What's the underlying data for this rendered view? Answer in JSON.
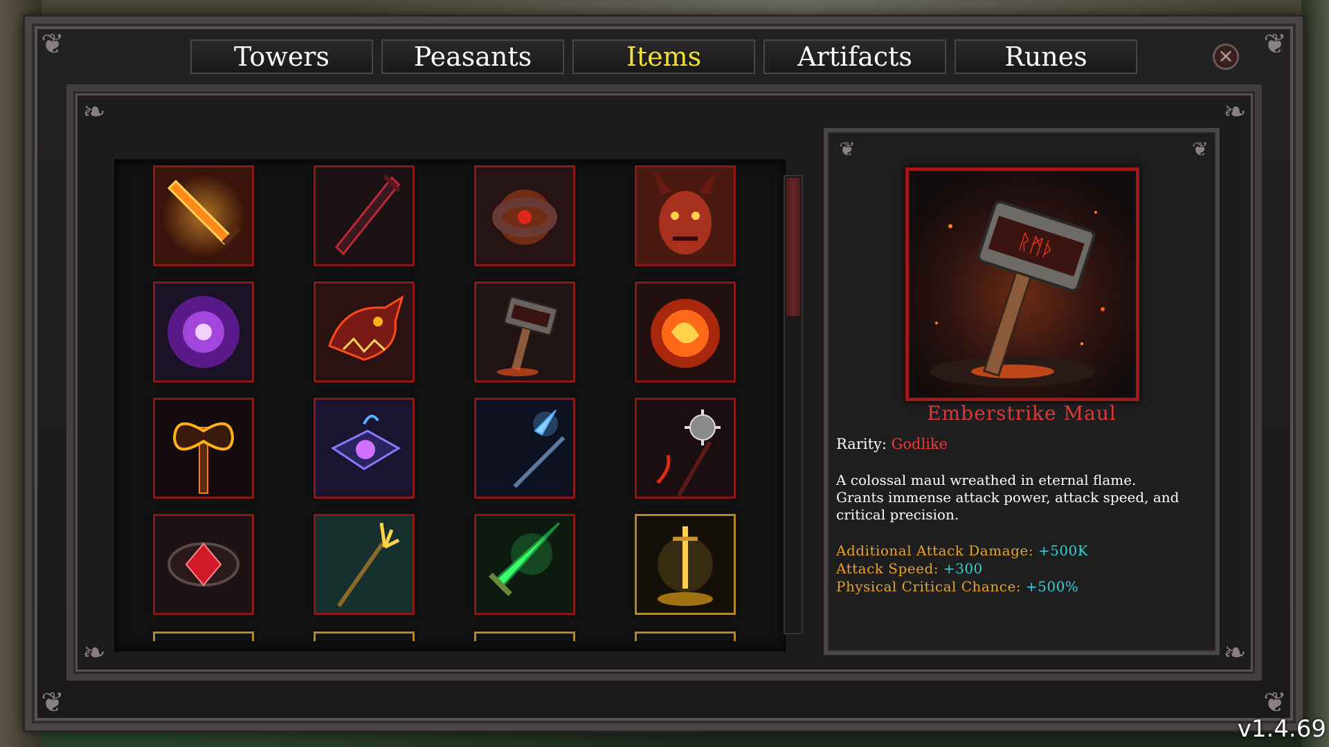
{
  "tabs": [
    {
      "label": "Towers",
      "active": false
    },
    {
      "label": "Peasants",
      "active": false
    },
    {
      "label": "Items",
      "active": true
    },
    {
      "label": "Artifacts",
      "active": false
    },
    {
      "label": "Runes",
      "active": false
    }
  ],
  "close_icon": "×",
  "items": [
    {
      "icon": "flaming-sword-icon",
      "rarity_border": "red"
    },
    {
      "icon": "dark-blade-icon",
      "rarity_border": "red"
    },
    {
      "icon": "fire-ring-icon",
      "rarity_border": "red"
    },
    {
      "icon": "demon-mask-icon",
      "rarity_border": "red"
    },
    {
      "icon": "purple-orb-icon",
      "rarity_border": "red"
    },
    {
      "icon": "dragon-head-icon",
      "rarity_border": "red"
    },
    {
      "icon": "ember-hammer-icon",
      "rarity_border": "red"
    },
    {
      "icon": "fire-orb-icon",
      "rarity_border": "red"
    },
    {
      "icon": "flame-axe-icon",
      "rarity_border": "red"
    },
    {
      "icon": "arcane-tome-icon",
      "rarity_border": "red"
    },
    {
      "icon": "ice-spear-icon",
      "rarity_border": "red"
    },
    {
      "icon": "spiked-mace-icon",
      "rarity_border": "red"
    },
    {
      "icon": "ruby-amulet-icon",
      "rarity_border": "red"
    },
    {
      "icon": "golden-trident-icon",
      "rarity_border": "red"
    },
    {
      "icon": "emerald-sword-icon",
      "rarity_border": "red"
    },
    {
      "icon": "golden-sword-icon",
      "rarity_border": "gold"
    }
  ],
  "selected_item": {
    "name": "Emberstrike Maul",
    "rarity_label": "Rarity:",
    "rarity": "Godlike",
    "description_lines": [
      "A colossal maul wreathed in eternal flame.",
      "Grants immense attack power, attack speed, and",
      "critical precision."
    ],
    "stats": [
      {
        "label": "Additional Attack Damage:",
        "value": "+500K"
      },
      {
        "label": "Attack Speed:",
        "value": "+300"
      },
      {
        "label": "Physical Critical Chance:",
        "value": "+500%"
      }
    ]
  },
  "scroll_position": 0,
  "version": "v1.4.69",
  "colors": {
    "active_tab": "#f2e23a",
    "item_name": "#e0383a",
    "rarity_godlike": "#ea3a3a",
    "stat_label": "#e8a32a",
    "stat_value": "#38d0d8",
    "border_red": "#8a1a1a",
    "border_gold": "#b08a2a"
  }
}
